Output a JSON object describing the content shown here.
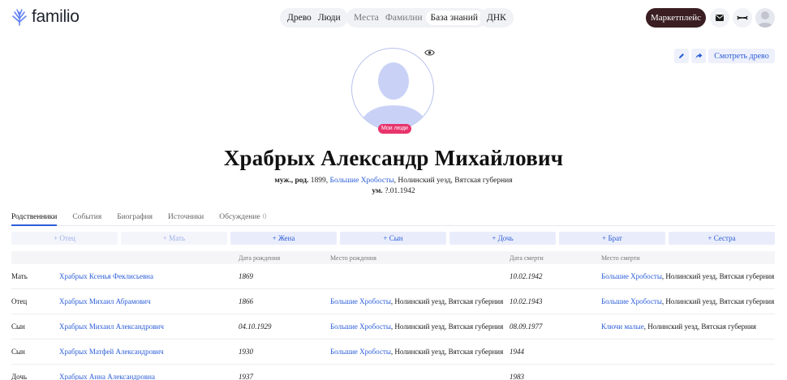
{
  "app": {
    "logo_text": "familio"
  },
  "nav": {
    "group1": [
      "Древо",
      "Люди"
    ],
    "group2": [
      "Места",
      "Фамилии",
      "База знаний"
    ],
    "group3": [
      "ДНК"
    ],
    "marketplace": "Маркетплейс"
  },
  "profile": {
    "badge": "Мои люди",
    "view_tree": "Смотреть древо",
    "name": "Храбрых Александр Михайлович",
    "birth_prefix": "муж., род.",
    "birth_year": " 1899, ",
    "birth_place_link": "Большие Хробосты",
    "birth_place_rest": ", Нолинский уезд, Вятская губерния",
    "death_prefix": "ум.",
    "death_date": " ?.01.1942"
  },
  "tabs": {
    "relatives": "Родственники",
    "events": "События",
    "biography": "Биография",
    "sources": "Источники",
    "discussion": "Обсуждение",
    "discussion_count": "0"
  },
  "add_buttons": {
    "father": "+ Отец",
    "mother": "+ Мать",
    "wife": "+ Жена",
    "son": "+ Сын",
    "daughter": "+ Дочь",
    "brother": "+ Брат",
    "sister": "+ Сестра"
  },
  "table": {
    "headers": {
      "birth_date": "Дата рождения",
      "birth_place": "Место рождения",
      "death_date": "Дата смерти",
      "death_place": "Место смерти"
    },
    "rows": [
      {
        "relation": "Мать",
        "name": "Храбрых Ксенья Феклисьевна",
        "birth_date": "1869",
        "birth_place_link": "",
        "birth_place_rest": "",
        "death_date": "10.02.1942",
        "death_place_link": "Большие Хробосты",
        "death_place_rest": ", Нолинский уезд, Вятская губерния"
      },
      {
        "relation": "Отец",
        "name": "Храбрых Михаил Абрамович",
        "birth_date": "1866",
        "birth_place_link": "Большие Хробосты",
        "birth_place_rest": ", Нолинский уезд, Вятская губерния",
        "death_date": "10.02.1943",
        "death_place_link": "Большие Хробосты",
        "death_place_rest": ", Нолинский уезд, Вятская губерния"
      },
      {
        "relation": "Сын",
        "name": "Храбрых Михаил Александрович",
        "birth_date": "04.10.1929",
        "birth_place_link": "Большие Хробосты",
        "birth_place_rest": ", Нолинский уезд, Вятская губерния",
        "death_date": "08.09.1977",
        "death_place_link": "Ключи малые",
        "death_place_rest": ", Нолинский уезд, Вятская губерния"
      },
      {
        "relation": "Сын",
        "name": "Храбрых Матфей Александрович",
        "birth_date": "1930",
        "birth_place_link": "Большие Хробосты",
        "birth_place_rest": ", Нолинский уезд, Вятская губерния",
        "death_date": "1944",
        "death_place_link": "",
        "death_place_rest": ""
      },
      {
        "relation": "Дочь",
        "name": "Храбрых Анна Александровна",
        "birth_date": "1937",
        "birth_place_link": "",
        "birth_place_rest": "",
        "death_date": "1983",
        "death_place_link": "",
        "death_place_rest": ""
      }
    ]
  },
  "colors": {
    "accent": "#2b5dd8",
    "marketplace_bg": "#3a1e22",
    "badge_bg": "#e8336c",
    "avatar_silhouette": "#c9d2f6"
  },
  "icons": {
    "logo": "tree-logo-icon",
    "mail": "mail-icon",
    "dna": "dna-icon",
    "user": "user-avatar-icon",
    "eye": "eye-icon",
    "edit": "pencil-icon",
    "share": "share-arrow-icon"
  }
}
